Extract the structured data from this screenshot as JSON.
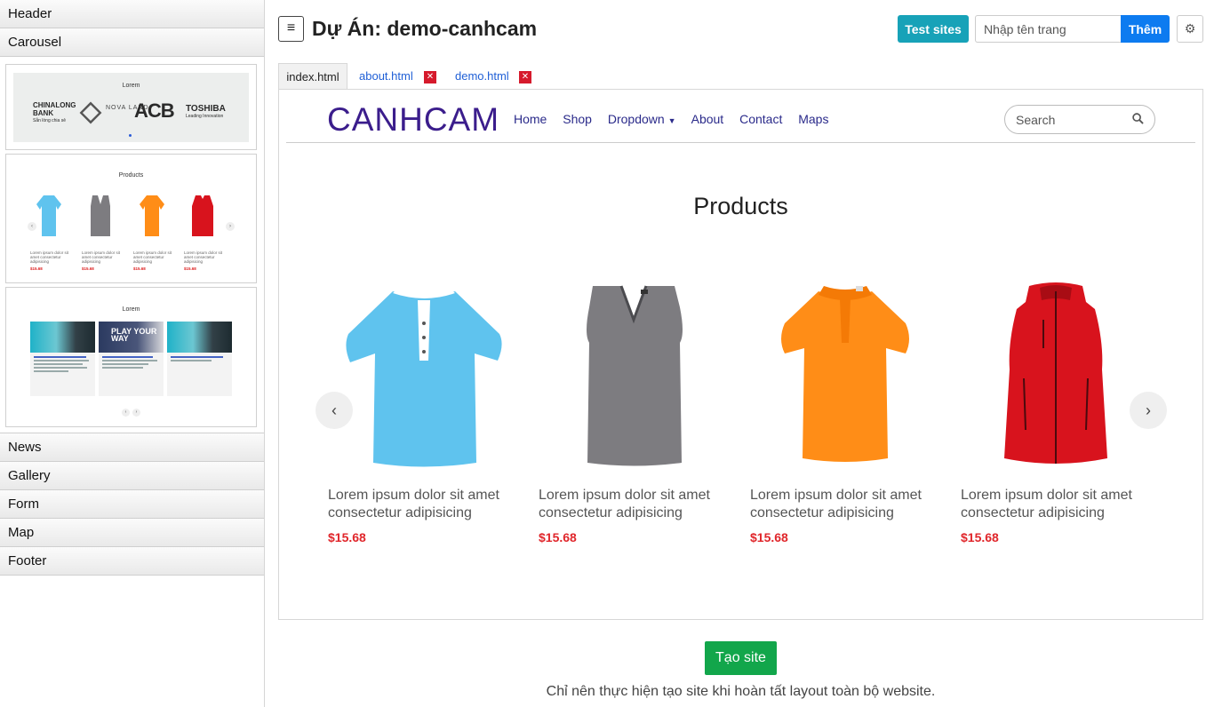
{
  "sidebar": {
    "top_items": [
      "Header",
      "Carousel"
    ],
    "bottom_items": [
      "News",
      "Gallery",
      "Form",
      "Map",
      "Footer"
    ],
    "previews": {
      "logos": {
        "title": "Lorem",
        "logo1": "CHINALONG BANK",
        "logo1_sub": "Sẵn lòng chia sẻ",
        "logo2": "NOVA LAND",
        "logo3": "ACB",
        "logo4": "TOSHIBA",
        "logo4_sub": "Leading Innovation"
      },
      "products": {
        "title": "Products"
      },
      "news": {
        "title": "Lorem",
        "card2_text": "PLAY YOUR WAY"
      }
    }
  },
  "topbar": {
    "title": "Dự Án: demo-canhcam",
    "test_button": "Test sites",
    "page_input_placeholder": "Nhập tên trang",
    "add_button": "Thêm"
  },
  "tabs": [
    {
      "label": "index.html",
      "active": true
    },
    {
      "label": "about.html",
      "active": false
    },
    {
      "label": "demo.html",
      "active": false
    }
  ],
  "site": {
    "brand": "CANHCAM",
    "nav": [
      "Home",
      "Shop",
      "Dropdown",
      "About",
      "Contact",
      "Maps"
    ],
    "search_placeholder": "Search",
    "section_title": "Products",
    "products": [
      {
        "line1": "Lorem ipsum dolor sit amet",
        "line2": "consectetur adipisicing",
        "price": "$15.68",
        "color": "#5fc3ee"
      },
      {
        "line1": "Lorem ipsum dolor sit amet",
        "line2": "consectetur adipisicing",
        "price": "$15.68",
        "color": "#7d7c80"
      },
      {
        "line1": "Lorem ipsum dolor sit amet",
        "line2": "consectetur adipisicing",
        "price": "$15.68",
        "color": "#ff8d17"
      },
      {
        "line1": "Lorem ipsum dolor sit amet",
        "line2": "consectetur adipisicing",
        "price": "$15.68",
        "color": "#d8131d"
      }
    ]
  },
  "footer": {
    "create_button": "Tạo site",
    "note": "Chỉ nên thực hiện tạo site khi hoàn tất layout toàn bộ website."
  },
  "colors": {
    "brand": "#3b1d8c",
    "test": "#17a2b8",
    "add": "#0d7bf0",
    "create": "#12a64b",
    "price": "#e0262b",
    "close": "#d61a2c"
  }
}
